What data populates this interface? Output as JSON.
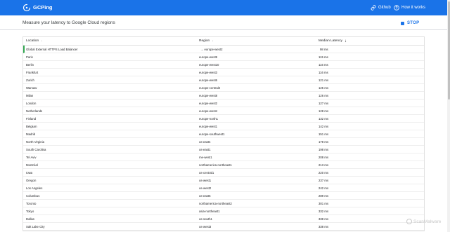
{
  "app": {
    "title": "GCPing",
    "nav": {
      "github_label": "Github",
      "how_label": "How it works"
    }
  },
  "header": {
    "subtitle": "Measure your latency to Google Cloud regions",
    "stop_label": "STOP"
  },
  "table": {
    "columns": {
      "location": "Location",
      "region": "Region",
      "latency": "Median Latency"
    },
    "rows": [
      {
        "location": "Global External HTTPS Load Balancer",
        "region": "→ europe-west2",
        "latency": "98 ms"
      },
      {
        "location": "Paris",
        "region": "europe-west9",
        "latency": "115 ms"
      },
      {
        "location": "Berlin",
        "region": "europe-west10",
        "latency": "116 ms"
      },
      {
        "location": "Frankfurt",
        "region": "europe-west3",
        "latency": "116 ms"
      },
      {
        "location": "Zurich",
        "region": "europe-west6",
        "latency": "121 ms"
      },
      {
        "location": "Warsaw",
        "region": "europe-central2",
        "latency": "125 ms"
      },
      {
        "location": "Milan",
        "region": "europe-west8",
        "latency": "126 ms"
      },
      {
        "location": "London",
        "region": "europe-west2",
        "latency": "127 ms"
      },
      {
        "location": "Netherlands",
        "region": "europe-west4",
        "latency": "128 ms"
      },
      {
        "location": "Finland",
        "region": "europe-north1",
        "latency": "132 ms"
      },
      {
        "location": "Belgium",
        "region": "europe-west1",
        "latency": "142 ms"
      },
      {
        "location": "Madrid",
        "region": "europe-southwest1",
        "latency": "151 ms"
      },
      {
        "location": "North Virginia",
        "region": "us-east4",
        "latency": "178 ms"
      },
      {
        "location": "South Carolina",
        "region": "us-east1",
        "latency": "198 ms"
      },
      {
        "location": "Tel Aviv",
        "region": "me-west1",
        "latency": "208 ms"
      },
      {
        "location": "Montréal",
        "region": "northamerica-northeast1",
        "latency": "213 ms"
      },
      {
        "location": "Iowa",
        "region": "us-central1",
        "latency": "220 ms"
      },
      {
        "location": "Oregon",
        "region": "us-west1",
        "latency": "237 ms"
      },
      {
        "location": "Los Angeles",
        "region": "us-west2",
        "latency": "242 ms"
      },
      {
        "location": "Columbus",
        "region": "us-east5",
        "latency": "289 ms"
      },
      {
        "location": "Toronto",
        "region": "northamerica-northeast2",
        "latency": "301 ms"
      },
      {
        "location": "Tokyo",
        "region": "asia-northeast1",
        "latency": "332 ms"
      },
      {
        "location": "Dallas",
        "region": "us-south1",
        "latency": "338 ms"
      },
      {
        "location": "Salt Lake City",
        "region": "us-west3",
        "latency": "338 ms"
      }
    ]
  },
  "watermark": "ScanMalware",
  "colors": {
    "appbar": "#1a73e8",
    "accent": "#1a73e8",
    "best_row_marker": "#34a853"
  }
}
